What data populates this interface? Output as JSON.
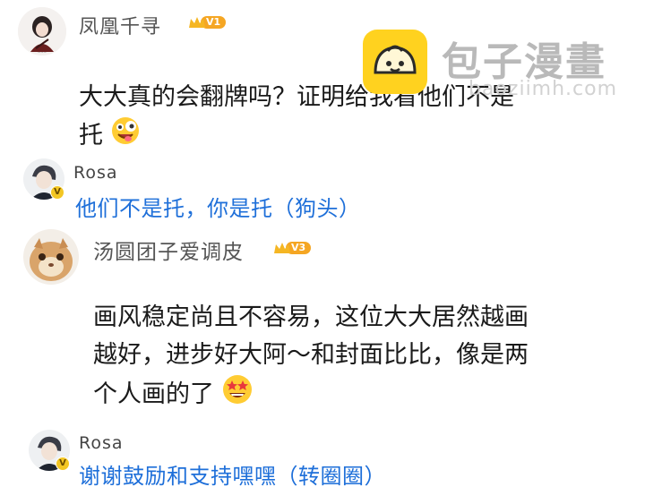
{
  "comments": [
    {
      "user": "凤凰千寻",
      "level": "V1",
      "text_line1": "大大真的会翻牌吗？证明给我看他们不是",
      "text_line2": "托"
    },
    {
      "user": "汤圆团子爱调皮",
      "level": "V3",
      "text_line1": "画风稳定尚且不容易，这位大大居然越画",
      "text_line2": "越好，进步好大阿～和封面比比，像是两",
      "text_line3": "个人画的了"
    }
  ],
  "replies": [
    {
      "user": "Rosa",
      "badge": "V",
      "text": "他们不是托，你是托（狗头）"
    },
    {
      "user": "Rosa",
      "badge": "V",
      "text": "谢谢鼓励和支持嘿嘿（转圈圈）"
    }
  ],
  "watermark": {
    "brand": "包子漫畫",
    "sub": "baoziimh.com"
  },
  "colors": {
    "reply_link": "#1e6fd9",
    "badge": "#f5a623",
    "brand_yellow": "#ffd21f"
  },
  "icons": [
    "crown-icon",
    "zany-face-emoji",
    "star-struck-emoji",
    "bun-logo-icon",
    "verified-v-icon"
  ]
}
